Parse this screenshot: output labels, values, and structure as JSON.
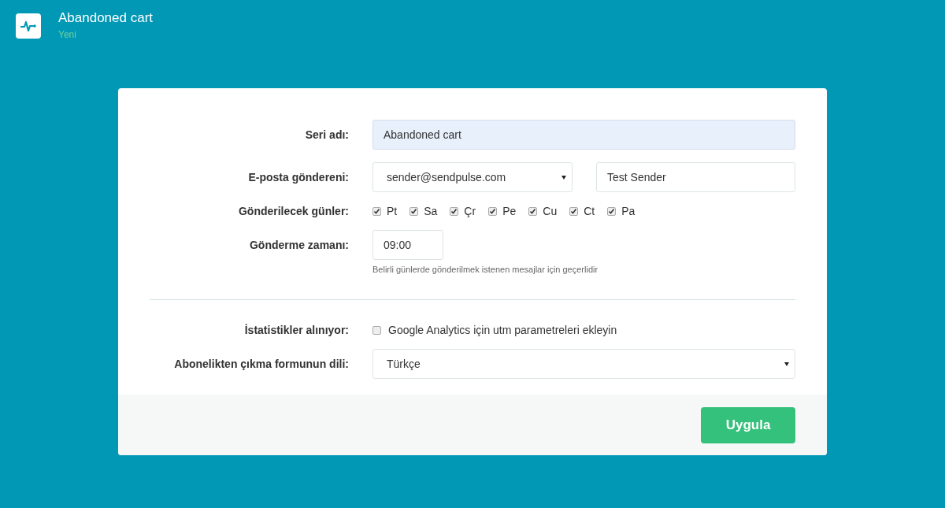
{
  "header": {
    "title": "Abandoned cart",
    "status": "Yeni"
  },
  "form": {
    "series_name": {
      "label": "Seri adı:",
      "value": "Abandoned cart"
    },
    "sender": {
      "label": "E-posta göndereni:",
      "email": "sender@sendpulse.com",
      "name": "Test Sender"
    },
    "days": {
      "label": "Gönderilecek günler:",
      "items": [
        {
          "label": "Pt",
          "checked": true
        },
        {
          "label": "Sa",
          "checked": true
        },
        {
          "label": "Çr",
          "checked": true
        },
        {
          "label": "Pe",
          "checked": true
        },
        {
          "label": "Cu",
          "checked": true
        },
        {
          "label": "Ct",
          "checked": true
        },
        {
          "label": "Pa",
          "checked": true
        }
      ]
    },
    "send_time": {
      "label": "Gönderme zamanı:",
      "value": "09:00",
      "hint": "Belirli günlerde gönderilmek istenen mesajlar için geçerlidir"
    },
    "statistics": {
      "label": "İstatistikler alınıyor:",
      "option": "Google Analytics için utm parametreleri ekleyin",
      "checked": false
    },
    "language": {
      "label": "Abonelikten çıkma formunun dili:",
      "value": "Türkçe"
    }
  },
  "apply_button": "Uygula"
}
